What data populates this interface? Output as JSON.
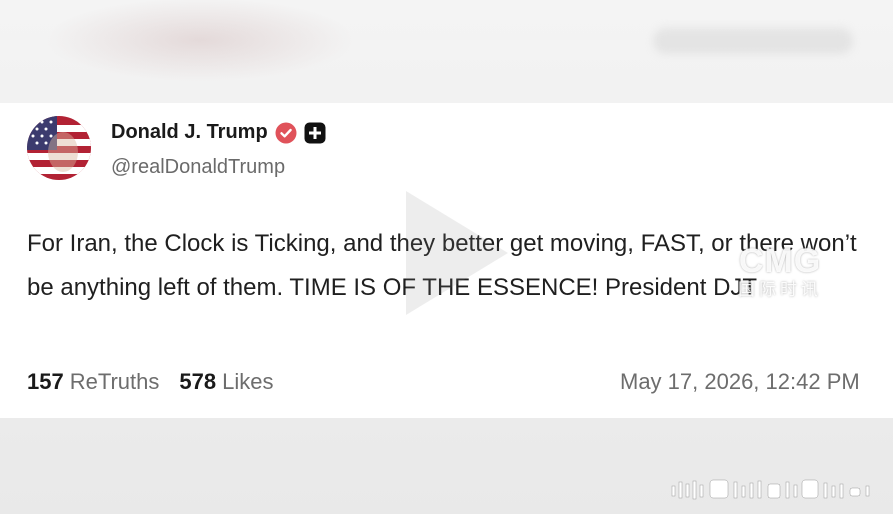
{
  "post": {
    "display_name": "Donald J. Trump",
    "handle": "@realDonaldTrump",
    "body": "For Iran, the Clock is Ticking, and they better get moving, FAST, or there won’t be anything left of them. TIME IS OF THE ESSENCE! President DJT",
    "retruths_count": "157",
    "retruths_label": "ReTruths",
    "likes_count": "578",
    "likes_label": "Likes",
    "timestamp": "May 17, 2026, 12:42 PM"
  },
  "watermark": {
    "logo": "CMG",
    "subtitle": "国际时讯"
  },
  "icons": {
    "verified": "verified-badge-icon",
    "app_badge": "plus-badge-icon",
    "play": "play-icon",
    "waveform": "audio-waveform-icon"
  },
  "colors": {
    "verified_badge": "#e0525a",
    "app_badge": "#111111",
    "stat_number": "#1a1a1a",
    "muted_text": "#6d6d6d"
  }
}
